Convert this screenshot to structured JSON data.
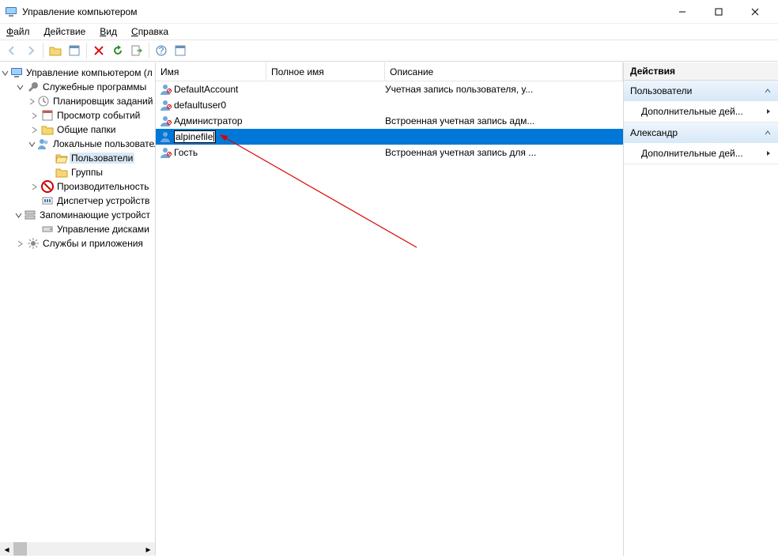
{
  "window": {
    "title": "Управление компьютером"
  },
  "menu": {
    "file": "Файл",
    "action": "Действие",
    "view": "Вид",
    "help": "Справка"
  },
  "tree": {
    "root": "Управление компьютером (л",
    "systools": "Служебные программы",
    "scheduler": "Планировщик заданий",
    "eventviewer": "Просмотр событий",
    "sharedfolders": "Общие папки",
    "localusers": "Локальные пользовател",
    "users": "Пользователи",
    "groups": "Группы",
    "perf": "Производительность",
    "devmgr": "Диспетчер устройств",
    "storage": "Запоминающие устройст",
    "diskmgr": "Управление дисками",
    "services": "Службы и приложения"
  },
  "list": {
    "cols": {
      "name": "Имя",
      "fullname": "Полное имя",
      "desc": "Описание"
    },
    "rows": [
      {
        "name": "DefaultAccount",
        "full": "",
        "desc": "Учетная запись пользователя, у...",
        "dim": true
      },
      {
        "name": "defaultuser0",
        "full": "",
        "desc": "",
        "dim": true
      },
      {
        "name": "Администратор",
        "full": "",
        "desc": "Встроенная учетная запись адм...",
        "dim": true
      },
      {
        "name": "alpinefile",
        "full": "",
        "desc": "",
        "editing": true,
        "selected": true
      },
      {
        "name": "Гость",
        "full": "",
        "desc": "Встроенная учетная запись для ...",
        "dim": true
      }
    ]
  },
  "actions": {
    "title": "Действия",
    "section1": "Пользователи",
    "section2": "Александр",
    "more": "Дополнительные дей..."
  }
}
